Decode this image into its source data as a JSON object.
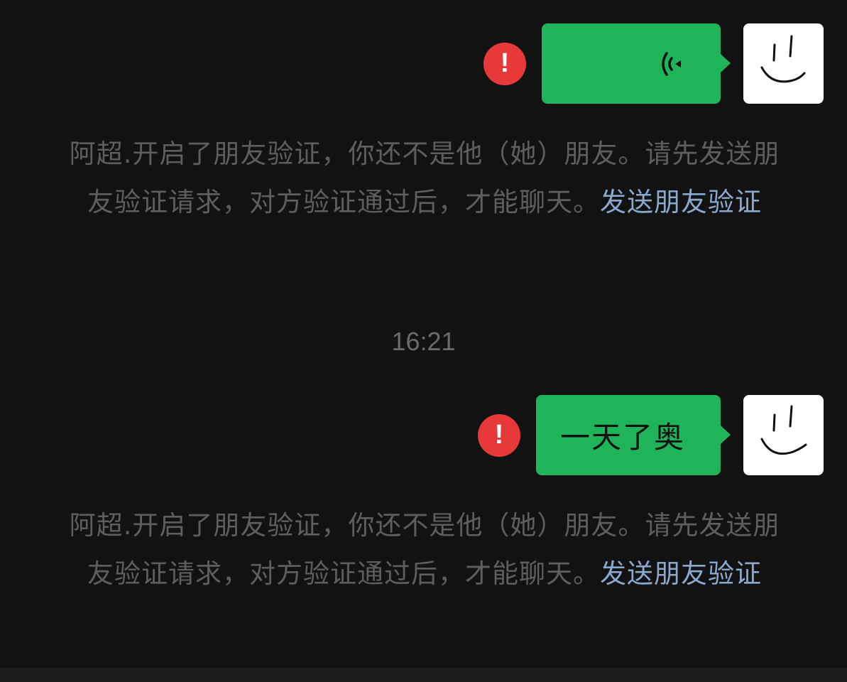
{
  "messages": [
    {
      "type": "voice",
      "status": "failed",
      "icons": {
        "status": "error-exclamation-icon",
        "voice": "voice-wave-icon",
        "avatar": "smiley-face-avatar"
      }
    },
    {
      "type": "text",
      "status": "failed",
      "text": "一天了奥",
      "icons": {
        "status": "error-exclamation-icon",
        "avatar": "smiley-face-avatar"
      }
    }
  ],
  "system_notice": {
    "text": "阿超.开启了朋友验证，你还不是他（她）朋友。请先发送朋友验证请求，对方验证通过后，才能聊天。",
    "link": "发送朋友验证"
  },
  "timestamp": "16:21",
  "error_mark": "!",
  "colors": {
    "background": "#121212",
    "bubble": "#20b45a",
    "error": "#e8393a",
    "notice_text": "#5e5e5e",
    "link": "#8aa9cf"
  }
}
